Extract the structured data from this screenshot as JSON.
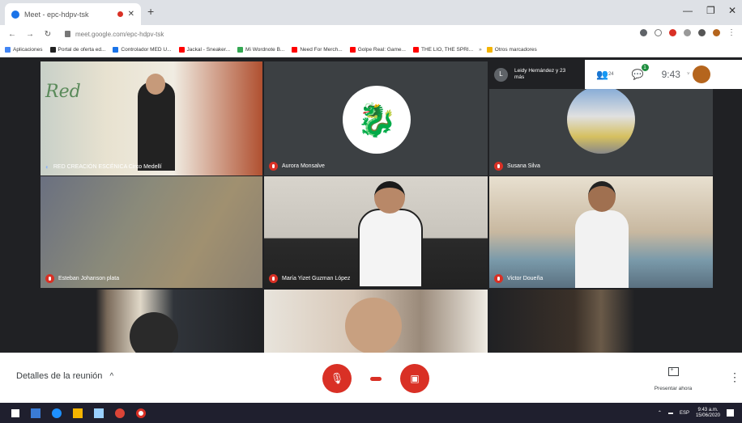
{
  "browser": {
    "tab_title": "Meet - epc-hdpv-tsk",
    "url": "meet.google.com/epc-hdpv-tsk",
    "bookmarks": [
      "Aplicaciones",
      "Portal de oferta ed...",
      "Controlador MED U...",
      "Jackal - Sneaker...",
      "Mi Wordnote B...",
      "Need For Merch...",
      "Golpe Real: Game...",
      "THE LIO, THE SPRI...",
      "Otros marcadores"
    ]
  },
  "meet": {
    "participant_chip": {
      "initial": "L",
      "text": "Leidy Hernández y 23 más"
    },
    "people_count": "24",
    "chat_badge": "1",
    "time": "9:43",
    "tiles": [
      {
        "name": "RED CREACIÓN ESCÉNICA Circo Medellí",
        "muted": false
      },
      {
        "name": "Aurora Monsalve",
        "muted": true
      },
      {
        "name": "Susana Silva",
        "muted": true
      },
      {
        "name": "Esteban Johanson plata",
        "muted": true
      },
      {
        "name": "María Yizet Guzman López",
        "muted": true
      },
      {
        "name": "Victor Doueña",
        "muted": true
      },
      {
        "name": "",
        "muted": false
      },
      {
        "name": "",
        "muted": false
      },
      {
        "name": "",
        "muted": false
      }
    ]
  },
  "controls": {
    "details_label": "Detalles de la reunión",
    "present_label": "Presentar ahora"
  },
  "taskbar": {
    "clock": "9:43 a.m.",
    "date": "15/06/2020",
    "lang": "ESP"
  },
  "colors": {
    "meet_bg": "#202124",
    "red": "#d93025",
    "tile": "#3c4043"
  }
}
